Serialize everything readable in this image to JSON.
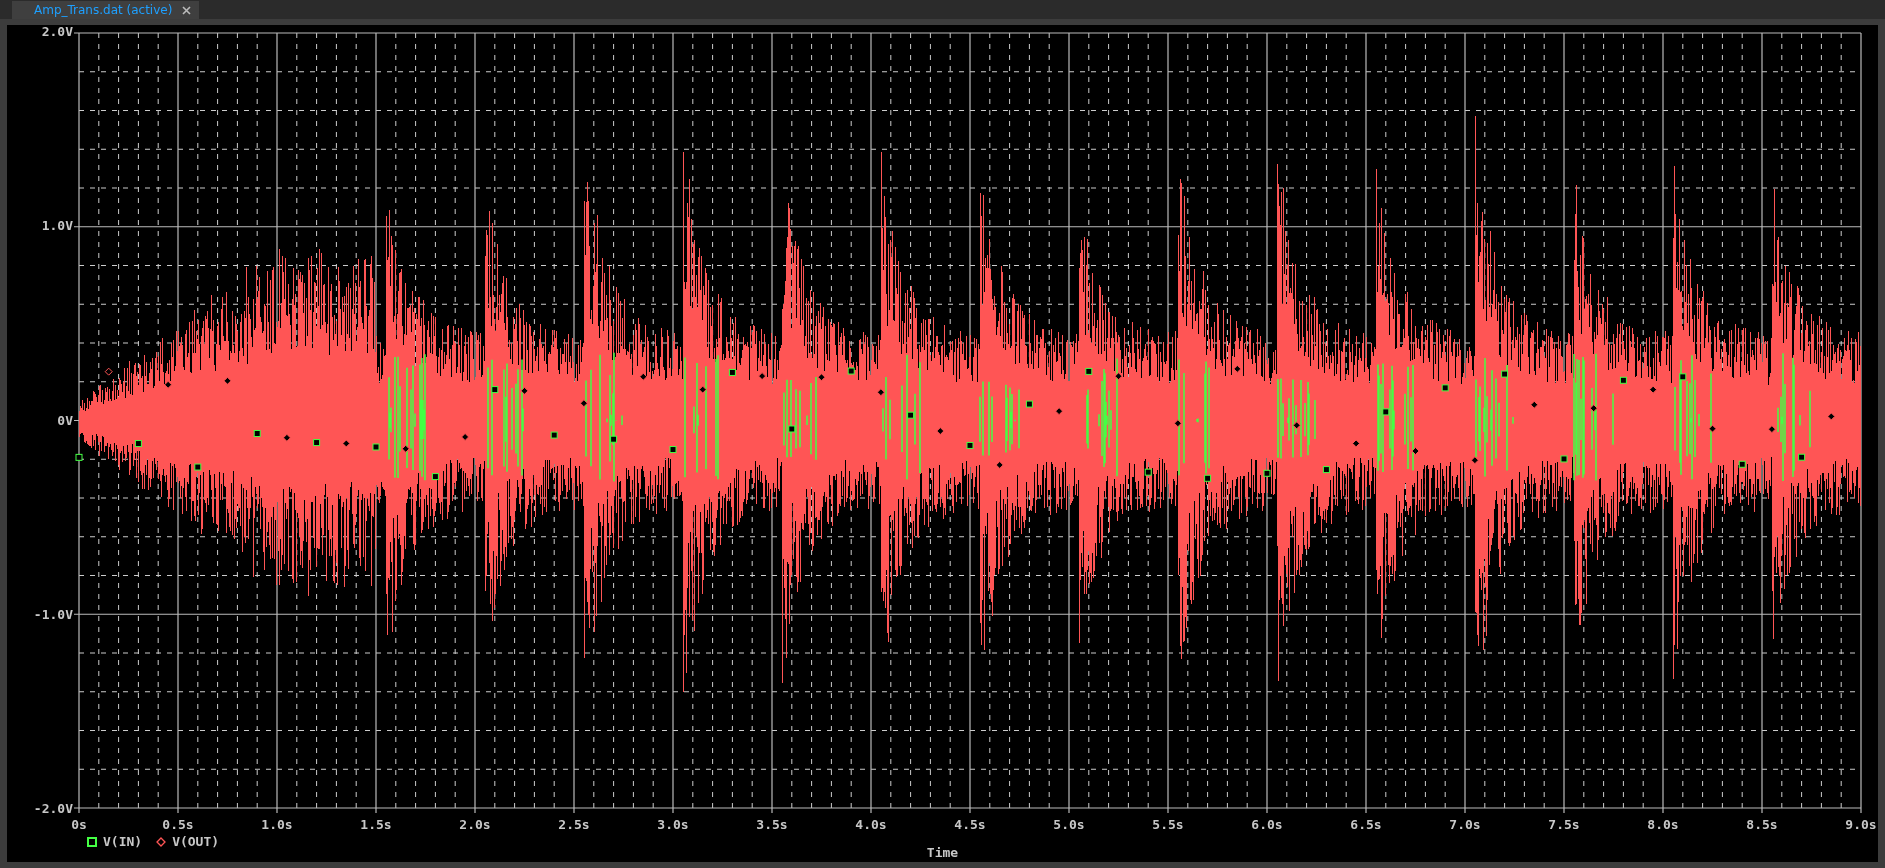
{
  "tabs": [
    {
      "label": "Amp_Trans.dat (active)",
      "selected": true
    }
  ],
  "plot": {
    "y_labels": [
      "2.0V",
      "1.0V",
      "0V",
      "-1.0V",
      "-2.0V"
    ],
    "x_labels": [
      "0s",
      "0.5s",
      "1.0s",
      "1.5s",
      "2.0s",
      "2.5s",
      "3.0s",
      "3.5s",
      "4.0s",
      "4.5s",
      "5.0s",
      "5.5s",
      "6.0s",
      "6.5s",
      "7.0s",
      "7.5s",
      "8.0s",
      "8.5s",
      "9.0s"
    ],
    "legend": [
      {
        "label": "V(IN)",
        "kind": "square",
        "color": "#44ff44"
      },
      {
        "label": "V(OUT)",
        "kind": "diamond",
        "color": "#ff5555"
      }
    ],
    "xlabel": "Time"
  }
}
